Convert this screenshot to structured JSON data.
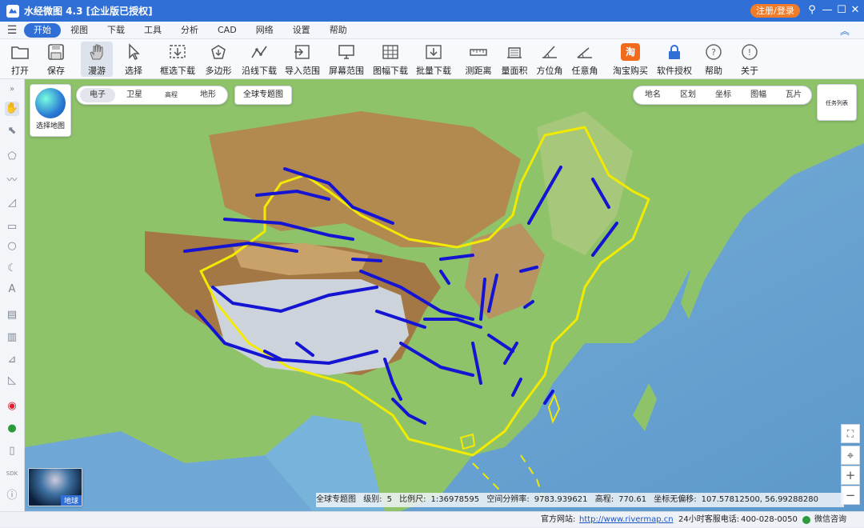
{
  "window": {
    "title": "水经微图 4.3 [企业版已授权]",
    "login_label": "注册/登录",
    "controls": [
      "⚲",
      "—",
      "☐",
      "✕"
    ]
  },
  "menu": {
    "items": [
      "开始",
      "视图",
      "下载",
      "工具",
      "分析",
      "CAD",
      "网络",
      "设置",
      "帮助"
    ],
    "active": "开始"
  },
  "toolbar": {
    "items": [
      "打开",
      "保存",
      "漫游",
      "选择",
      "框选下载",
      "多边形",
      "沿线下载",
      "导入范围",
      "屏幕范围",
      "图幅下载",
      "批量下载",
      "测距离",
      "量面积",
      "方位角",
      "任意角",
      "淘宝购买",
      "软件授权",
      "帮助",
      "关于"
    ],
    "active": "漫游",
    "taobao_badge": "淘"
  },
  "map": {
    "select_map_label": "选择地图",
    "map_types": [
      "电子",
      "卫星",
      "高程",
      "地形"
    ],
    "selected_type": "电子",
    "global_topic_button": "全球专题图",
    "layers": [
      "地名",
      "区划",
      "坐标",
      "图幅",
      "瓦片"
    ],
    "task_list_label": "任务列表",
    "minimap_label": "地球"
  },
  "status": {
    "layer_name": "全球专题图",
    "level_label": "级别:",
    "level": "5",
    "scale_label": "比例尺:",
    "scale": "1:36978595",
    "resolution_label": "空间分辨率:",
    "resolution": "9783.939621",
    "elevation_label": "高程:",
    "elevation": "770.61",
    "coords_label": "坐标无偏移:",
    "coords": "107.57812500, 56.99288280"
  },
  "footer": {
    "site_label": "官方网站:",
    "site_url": "http://www.rivermap.cn",
    "hotline_label": "24小时客服电话:",
    "hotline": "400-028-0050",
    "wechat_label": "微信咨询"
  },
  "colors": {
    "brand_blue": "#2f6fd6",
    "login_orange": "#f07c2a",
    "border_yellow": "#f2ea00",
    "fault_blue": "#1414d2"
  }
}
